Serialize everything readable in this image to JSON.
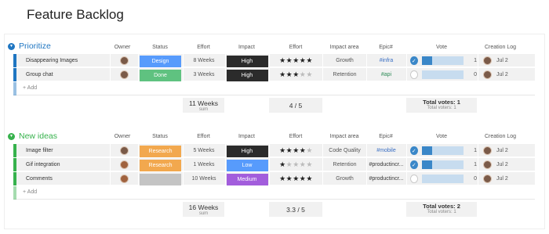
{
  "page": {
    "title": "Feature Backlog"
  },
  "columns": {
    "owner": "Owner",
    "status": "Status",
    "effort": "Effort",
    "impact": "Impact",
    "effort_stars": "Effort",
    "impact_area": "Impact area",
    "epic": "Epic#",
    "vote": "Vote",
    "creation_log": "Creation Log"
  },
  "colors": {
    "prioritize": "#1f76c2",
    "new_ideas": "#37b24d",
    "status_design": "#579bfc",
    "status_done": "#5fc280",
    "status_research": "#f2a84e",
    "status_empty": "#c4c4c4",
    "impact_high": "#2b2b2b",
    "impact_low": "#579bfc",
    "impact_medium": "#a25ddc"
  },
  "groups": [
    {
      "title": "Prioritize",
      "add_label": "+ Add",
      "rows": [
        {
          "name": "Disappearing Images",
          "status": "Design",
          "status_color": "#579bfc",
          "effort": "8 Weeks",
          "impact": "High",
          "impact_color": "#2b2b2b",
          "stars": 5,
          "impact_area": "Growth",
          "epic": "#infra",
          "epic_style": "link",
          "voted": true,
          "vote_fill": 0.25,
          "votes": "1",
          "log": "Jul 2"
        },
        {
          "name": "Group chat",
          "status": "Done",
          "status_color": "#5fc280",
          "effort": "3 Weeks",
          "impact": "High",
          "impact_color": "#2b2b2b",
          "stars": 3,
          "impact_area": "Retention",
          "epic": "#api",
          "epic_style": "green",
          "voted": false,
          "vote_fill": 0,
          "votes": "0",
          "log": "Jul 2"
        }
      ],
      "summary": {
        "effort_total": "11 Weeks",
        "effort_sub": "sum",
        "stars_avg": "4 / 5",
        "votes_total": "Total votes: 1",
        "votes_sub": "Total voters: 1"
      }
    },
    {
      "title": "New ideas",
      "add_label": "+ Add",
      "rows": [
        {
          "name": "Image filter",
          "status": "Research",
          "status_color": "#f2a84e",
          "effort": "5 Weeks",
          "impact": "High",
          "impact_color": "#2b2b2b",
          "stars": 4,
          "impact_area": "Code Quality",
          "epic": "#mobile",
          "epic_style": "link",
          "voted": true,
          "vote_fill": 0.25,
          "votes": "1",
          "log": "Jul 2"
        },
        {
          "name": "Gif integration",
          "status": "Research",
          "status_color": "#f2a84e",
          "effort": "1 Weeks",
          "impact": "Low",
          "impact_color": "#579bfc",
          "stars": 1,
          "impact_area": "Retention",
          "epic": "#productincr...",
          "epic_style": "plain",
          "voted": true,
          "vote_fill": 0.25,
          "votes": "1",
          "log": "Jul 2"
        },
        {
          "name": "Comments",
          "status": "",
          "status_color": "#c4c4c4",
          "effort": "10 Weeks",
          "impact": "Medium",
          "impact_color": "#a25ddc",
          "stars": 5,
          "impact_area": "Growth",
          "epic": "#productincr...",
          "epic_style": "plain",
          "voted": false,
          "vote_fill": 0,
          "votes": "0",
          "log": "Jul 2"
        }
      ],
      "summary": {
        "effort_total": "16 Weeks",
        "effort_sub": "sum",
        "stars_avg": "3.3 / 5",
        "votes_total": "Total votes: 2",
        "votes_sub": "Total voters: 1"
      }
    }
  ]
}
